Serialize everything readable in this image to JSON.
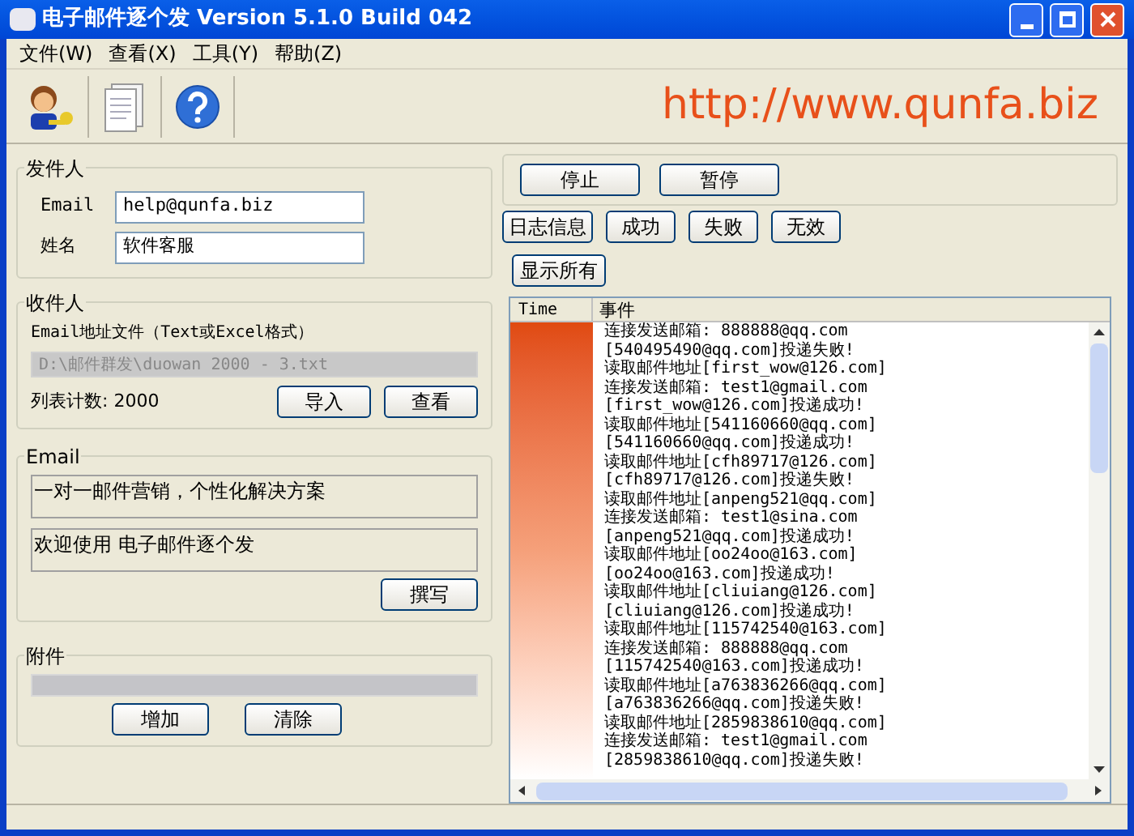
{
  "window": {
    "title": "电子邮件逐个发 Version 5.1.0 Build 042"
  },
  "menu": [
    "文件(W)",
    "查看(X)",
    "工具(Y)",
    "帮助(Z)"
  ],
  "banner": "http://www.qunfa.biz",
  "sender": {
    "title": "发件人",
    "fields": [
      {
        "label": "Email",
        "value": "help@qunfa.biz"
      },
      {
        "label": "姓名",
        "value": "软件客服"
      }
    ]
  },
  "recipients": {
    "title": "收件人",
    "file_label": "Email地址文件（Text或Excel格式）",
    "file_path": "D:\\邮件群发\\duowan 2000 - 3.txt",
    "file_disabled": true,
    "count": "列表计数: 2000",
    "buttons": [
      "导入",
      "查看"
    ]
  },
  "email": {
    "title": "Email",
    "subject": "一对一邮件营销，个性化解决方案",
    "body": "欢迎使用 电子邮件逐个发",
    "buttons": [
      "撰写"
    ]
  },
  "attachment": {
    "title": "附件",
    "buttons": [
      "增加",
      "清除"
    ]
  },
  "controls": [
    "停止",
    "暂停"
  ],
  "filters": [
    "日志信息",
    "成功",
    "失败",
    "无效"
  ],
  "show_all": "显示所有",
  "log": {
    "columns": [
      "Time",
      "事件"
    ],
    "rows": [
      "连接发送邮箱: 888888@qq.com",
      "[540495490@qq.com]投递失败!",
      "读取邮件地址[first_wow@126.com]",
      "连接发送邮箱: test1@gmail.com",
      "[first_wow@126.com]投递成功!",
      "读取邮件地址[541160660@qq.com]",
      "[541160660@qq.com]投递成功!",
      "读取邮件地址[cfh89717@126.com]",
      "[cfh89717@126.com]投递失败!",
      "读取邮件地址[anpeng521@qq.com]",
      "连接发送邮箱: test1@sina.com",
      "[anpeng521@qq.com]投递成功!",
      "读取邮件地址[oo24oo@163.com]",
      "[oo24oo@163.com]投递成功!",
      "读取邮件地址[cliuiang@126.com]",
      "[cliuiang@126.com]投递成功!",
      "读取邮件地址[115742540@163.com]",
      "连接发送邮箱: 888888@qq.com",
      "[115742540@163.com]投递成功!",
      "读取邮件地址[a763836266@qq.com]",
      "[a763836266@qq.com]投递失败!",
      "读取邮件地址[2859838610@qq.com]",
      "连接发送邮箱: test1@gmail.com",
      "[2859838610@qq.com]投递失败!"
    ]
  }
}
